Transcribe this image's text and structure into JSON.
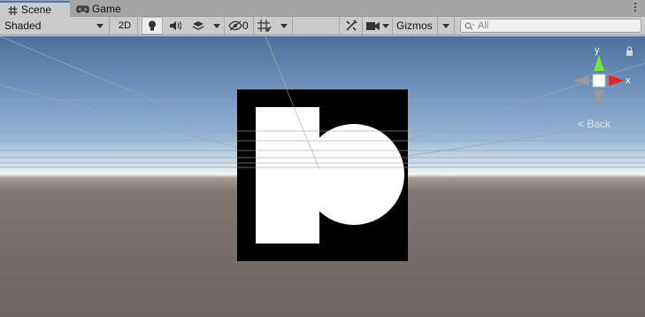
{
  "tabs": [
    {
      "label": "Scene",
      "icon": "grid-icon",
      "active": true
    },
    {
      "label": "Game",
      "icon": "gamepad-icon",
      "active": false
    }
  ],
  "toolbar": {
    "shading_mode": "Shaded",
    "mode_2d": "2D",
    "hidden_count": "0",
    "gizmos_label": "Gizmos",
    "search_placeholder": "All"
  },
  "gizmo": {
    "y_label": "y",
    "x_label": "x",
    "back_label": "Back"
  },
  "colors": {
    "tab_active_accent": "#3a79d8",
    "axis_y": "#76e43a",
    "axis_x": "#e02a24"
  }
}
